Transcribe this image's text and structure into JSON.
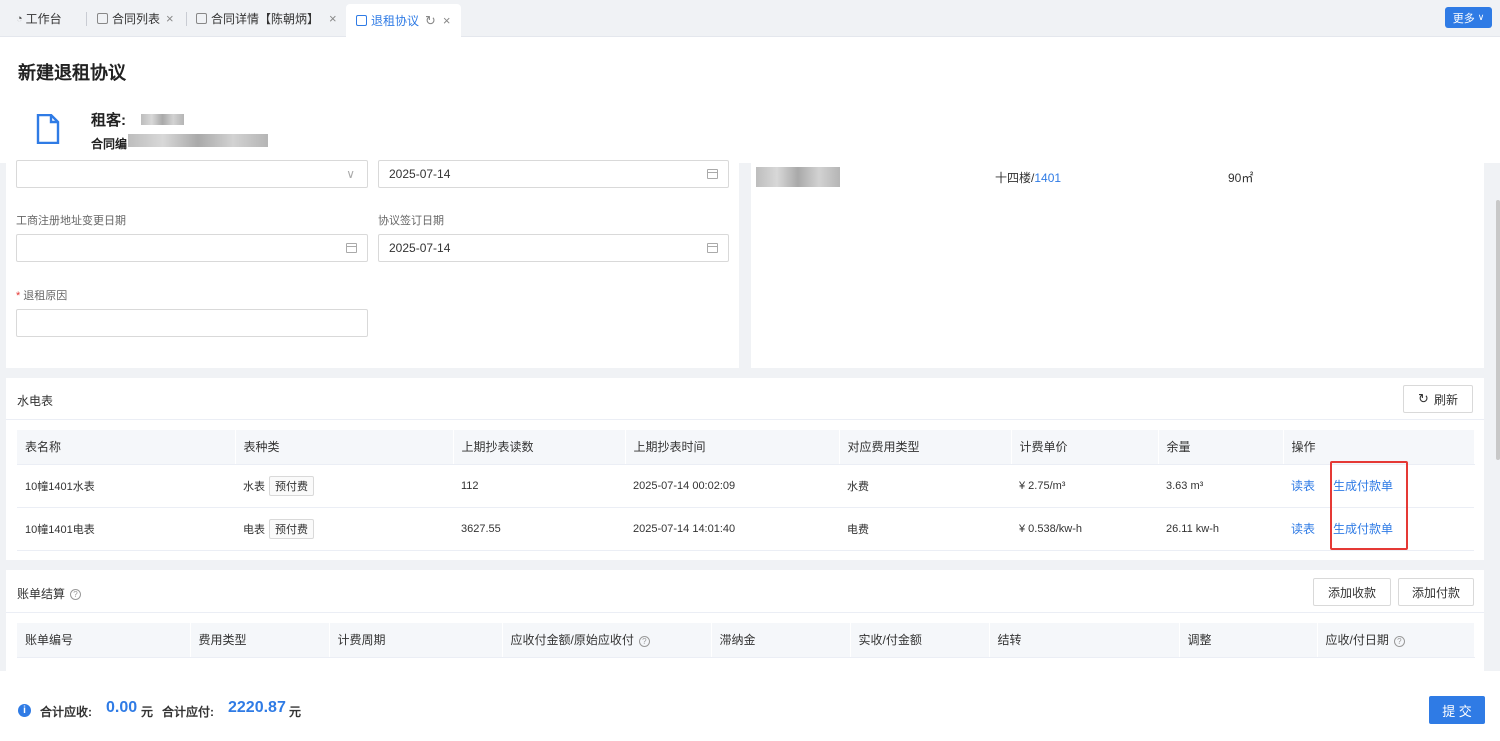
{
  "tabs": [
    {
      "label": "工作台",
      "icon": "dashboard-icon"
    },
    {
      "label": "合同列表",
      "icon": "list-icon"
    },
    {
      "label": "合同详情【陈朝炳】",
      "icon": "document-icon"
    },
    {
      "label": "退租协议",
      "icon": "document-icon",
      "active": true
    }
  ],
  "more_label": "更多",
  "page_title": "新建退租协议",
  "tenant_label": "租客:",
  "contract_label": "合同编",
  "form": {
    "date1_value": "2025-07-14",
    "biz_addr_label": "工商注册地址变更日期",
    "sign_date_label": "协议签订日期",
    "sign_date_value": "2025-07-14",
    "reason_label": "退租原因"
  },
  "room": {
    "floor": "十四楼/",
    "room_no": "1401",
    "area": "90㎡"
  },
  "meters": {
    "title": "水电表",
    "refresh_label": "刷新",
    "columns": [
      "表名称",
      "表种类",
      "上期抄表读数",
      "上期抄表时间",
      "对应费用类型",
      "计费单价",
      "余量",
      "操作"
    ],
    "rows": [
      {
        "name": "10幢1401水表",
        "kind": "水表",
        "tag": "预付费",
        "reading": "112",
        "time": "2025-07-14 00:02:09",
        "fee_type": "水费",
        "price": "¥ 2.75/m³",
        "balance": "3.63 m³",
        "read_action": "读表",
        "pay_action": "生成付款单"
      },
      {
        "name": "10幢1401电表",
        "kind": "电表",
        "tag": "预付费",
        "reading": "3627.55",
        "time": "2025-07-14 14:01:40",
        "fee_type": "电费",
        "price": "¥ 0.538/kw-h",
        "balance": "26.11 kw-h",
        "read_action": "读表",
        "pay_action": "生成付款单"
      }
    ]
  },
  "bills": {
    "title": "账单结算",
    "add_income_label": "添加收款",
    "add_payment_label": "添加付款",
    "columns": [
      "账单编号",
      "费用类型",
      "计费周期",
      "应收付金额/原始应收付",
      "滞纳金",
      "实收/付金额",
      "结转",
      "调整",
      "应收/付日期"
    ]
  },
  "footer": {
    "receivable_label": "合计应收:",
    "receivable_value": "0.00",
    "receivable_unit": "元",
    "payable_label": "合计应付:",
    "payable_value": "2220.87",
    "payable_unit": "元",
    "submit_label": "提 交"
  },
  "colors": {
    "accent": "#2f7be5",
    "highlight": "#e53935"
  }
}
